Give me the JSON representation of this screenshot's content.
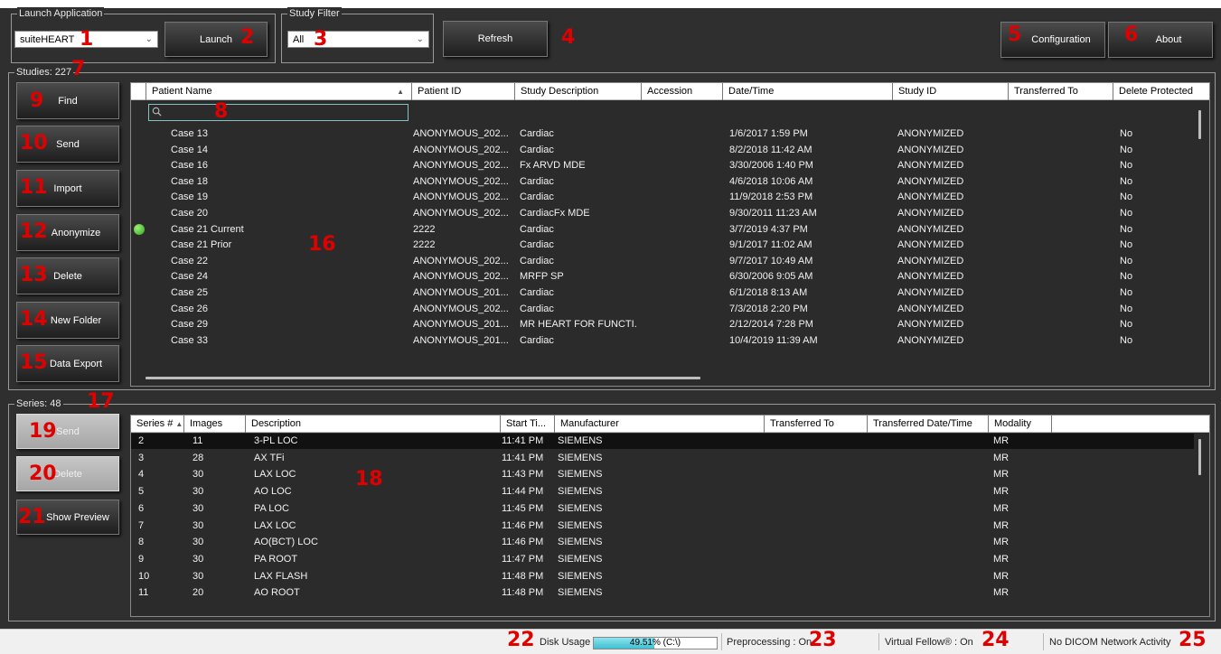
{
  "launch": {
    "group_title": "Launch Application",
    "app_select": "suiteHEART",
    "launch_label": "Launch"
  },
  "study_filter": {
    "group_title": "Study Filter",
    "value": "All"
  },
  "toolbar": {
    "refresh_label": "Refresh",
    "configuration_label": "Configuration",
    "about_label": "About"
  },
  "studies": {
    "group_title": "Studies: 227",
    "side_buttons": [
      "Find",
      "Send",
      "Import",
      "Anonymize",
      "Delete",
      "New Folder",
      "Data Export"
    ],
    "columns": [
      "Patient Name",
      "Patient ID",
      "Study Description",
      "Accession",
      "Date/Time",
      "Study ID",
      "Transferred To",
      "Delete Protected"
    ],
    "sort_indicator": "▲",
    "rows": [
      {
        "name": "Case 13",
        "pid": "ANONYMOUS_202...",
        "desc": "Cardiac",
        "acc": "",
        "date": "1/6/2017 1:59 PM",
        "sid": "ANONYMIZED",
        "to": "",
        "prot": "No"
      },
      {
        "name": "Case 14",
        "pid": "ANONYMOUS_202...",
        "desc": "Cardiac",
        "acc": "",
        "date": "8/2/2018 11:42 AM",
        "sid": "ANONYMIZED",
        "to": "",
        "prot": "No"
      },
      {
        "name": "Case 16",
        "pid": "ANONYMOUS_202...",
        "desc": "Fx ARVD MDE",
        "acc": "",
        "date": "3/30/2006 1:40 PM",
        "sid": "ANONYMIZED",
        "to": "",
        "prot": "No"
      },
      {
        "name": "Case 18",
        "pid": "ANONYMOUS_202...",
        "desc": "Cardiac",
        "acc": "",
        "date": "4/6/2018 10:06 AM",
        "sid": "ANONYMIZED",
        "to": "",
        "prot": "No"
      },
      {
        "name": "Case 19",
        "pid": "ANONYMOUS_202...",
        "desc": "Cardiac",
        "acc": "",
        "date": "11/9/2018 2:53 PM",
        "sid": "ANONYMIZED",
        "to": "",
        "prot": "No"
      },
      {
        "name": "Case 20",
        "pid": "ANONYMOUS_202...",
        "desc": "CardiacFx MDE",
        "acc": "",
        "date": "9/30/2011 11:23 AM",
        "sid": "ANONYMIZED",
        "to": "",
        "prot": "No"
      },
      {
        "name": "Case 21 Current",
        "pid": "2222",
        "desc": "Cardiac",
        "acc": "",
        "date": "3/7/2019 4:37 PM",
        "sid": "ANONYMIZED",
        "to": "",
        "prot": "No",
        "current": true
      },
      {
        "name": "Case 21 Prior",
        "pid": "2222",
        "desc": "Cardiac",
        "acc": "",
        "date": "9/1/2017 11:02 AM",
        "sid": "ANONYMIZED",
        "to": "",
        "prot": "No"
      },
      {
        "name": "Case 22",
        "pid": "ANONYMOUS_202...",
        "desc": "Cardiac",
        "acc": "",
        "date": "9/7/2017 10:49 AM",
        "sid": "ANONYMIZED",
        "to": "",
        "prot": "No"
      },
      {
        "name": "Case 24",
        "pid": "ANONYMOUS_202...",
        "desc": "MRFP SP",
        "acc": "",
        "date": "6/30/2006 9:05 AM",
        "sid": "ANONYMIZED",
        "to": "",
        "prot": "No"
      },
      {
        "name": "Case 25",
        "pid": "ANONYMOUS_201...",
        "desc": "Cardiac",
        "acc": "",
        "date": "6/1/2018 8:13 AM",
        "sid": "ANONYMIZED",
        "to": "",
        "prot": "No"
      },
      {
        "name": "Case 26",
        "pid": "ANONYMOUS_202...",
        "desc": "Cardiac",
        "acc": "",
        "date": "7/3/2018 2:20 PM",
        "sid": "ANONYMIZED",
        "to": "",
        "prot": "No"
      },
      {
        "name": "Case 29",
        "pid": "ANONYMOUS_201...",
        "desc": "MR HEART FOR FUNCTI...",
        "acc": "",
        "date": "2/12/2014 7:28 PM",
        "sid": "ANONYMIZED",
        "to": "",
        "prot": "No"
      },
      {
        "name": "Case 33",
        "pid": "ANONYMOUS_201...",
        "desc": "Cardiac",
        "acc": "",
        "date": "10/4/2019 11:39 AM",
        "sid": "ANONYMIZED",
        "to": "",
        "prot": "No"
      }
    ]
  },
  "series": {
    "group_title": "Series: 48",
    "side_buttons": [
      "Send",
      "Delete",
      "Show Preview"
    ],
    "columns": [
      "Series #",
      "Images",
      "Description",
      "Start Ti...",
      "Manufacturer",
      "Transferred To",
      "Transferred Date/Time",
      "Modality"
    ],
    "sort_indicator": "▲",
    "rows": [
      {
        "num": "2",
        "img": "11",
        "desc": "3-PL LOC",
        "time": "11:41 PM",
        "mfr": "SIEMENS",
        "to": "",
        "tdt": "",
        "mod": "MR"
      },
      {
        "num": "3",
        "img": "28",
        "desc": "AX TFi",
        "time": "11:41 PM",
        "mfr": "SIEMENS",
        "to": "",
        "tdt": "",
        "mod": "MR"
      },
      {
        "num": "4",
        "img": "30",
        "desc": "LAX LOC",
        "time": "11:43 PM",
        "mfr": "SIEMENS",
        "to": "",
        "tdt": "",
        "mod": "MR"
      },
      {
        "num": "5",
        "img": "30",
        "desc": "AO LOC",
        "time": "11:44 PM",
        "mfr": "SIEMENS",
        "to": "",
        "tdt": "",
        "mod": "MR"
      },
      {
        "num": "6",
        "img": "30",
        "desc": "PA LOC",
        "time": "11:45 PM",
        "mfr": "SIEMENS",
        "to": "",
        "tdt": "",
        "mod": "MR"
      },
      {
        "num": "7",
        "img": "30",
        "desc": "LAX LOC",
        "time": "11:46 PM",
        "mfr": "SIEMENS",
        "to": "",
        "tdt": "",
        "mod": "MR"
      },
      {
        "num": "8",
        "img": "30",
        "desc": "AO(BCT) LOC",
        "time": "11:46 PM",
        "mfr": "SIEMENS",
        "to": "",
        "tdt": "",
        "mod": "MR"
      },
      {
        "num": "9",
        "img": "30",
        "desc": "PA ROOT",
        "time": "11:47 PM",
        "mfr": "SIEMENS",
        "to": "",
        "tdt": "",
        "mod": "MR"
      },
      {
        "num": "10",
        "img": "30",
        "desc": "LAX FLASH",
        "time": "11:48 PM",
        "mfr": "SIEMENS",
        "to": "",
        "tdt": "",
        "mod": "MR"
      },
      {
        "num": "11",
        "img": "20",
        "desc": "AO ROOT",
        "time": "11:48 PM",
        "mfr": "SIEMENS",
        "to": "",
        "tdt": "",
        "mod": "MR"
      }
    ]
  },
  "status": {
    "disk_label": "Disk Usage",
    "disk_value": "49.51% (C:\\)",
    "disk_fraction": 0.4951,
    "preprocessing": "Preprocessing : On",
    "virtual_fellow": "Virtual Fellow® : On",
    "network": "No DICOM Network Activity"
  },
  "markers": [
    "1",
    "2",
    "3",
    "4",
    "5",
    "6",
    "7",
    "8",
    "9",
    "10",
    "11",
    "12",
    "13",
    "14",
    "15",
    "16",
    "17",
    "18",
    "19",
    "20",
    "21",
    "22",
    "23",
    "24",
    "25"
  ],
  "colors": {
    "background": "#2f2f2f",
    "marker": "#e00000",
    "disk_fill": "#3fc0d2",
    "current_dot": "#2ea31c"
  }
}
